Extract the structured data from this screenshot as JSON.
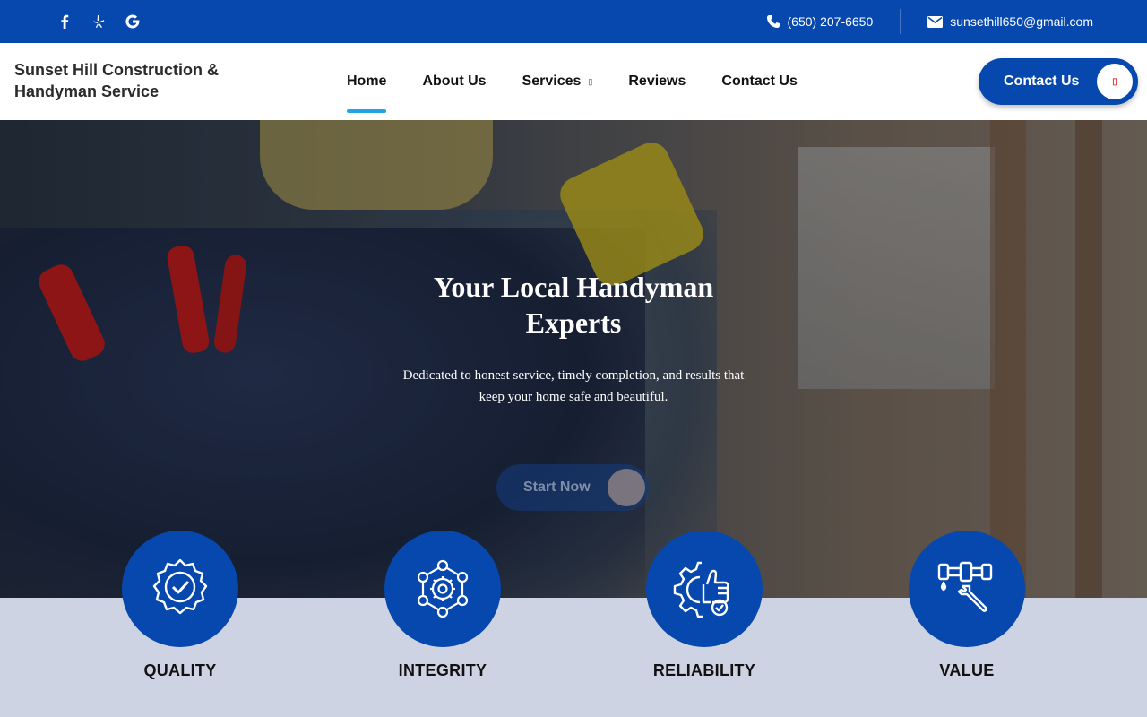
{
  "topbar": {
    "social": [
      {
        "name": "facebook-icon",
        "glyph": "f"
      },
      {
        "name": "yelp-icon",
        "glyph": "✻"
      },
      {
        "name": "google-icon",
        "glyph": "G"
      }
    ],
    "phone": "(650) 207-6650",
    "email": "sunsethill650@gmail.com"
  },
  "header": {
    "logo_line1": "Sunset Hill Construction &",
    "logo_line2": "Handyman Service",
    "nav": [
      {
        "label": "Home"
      },
      {
        "label": "About Us"
      },
      {
        "label": "Services"
      },
      {
        "label": "Reviews"
      },
      {
        "label": "Contact Us"
      }
    ],
    "cta_label": "Contact Us"
  },
  "hero": {
    "title": "Your Local Handyman Experts",
    "subtitle": "Dedicated to honest service, timely completion, and results that keep your home safe and beautiful.",
    "button_label": "Start Now"
  },
  "features": [
    {
      "label": "QUALITY",
      "icon": "quality-badge-icon"
    },
    {
      "label": "INTEGRITY",
      "icon": "integrity-network-icon"
    },
    {
      "label": "RELIABILITY",
      "icon": "reliability-gear-thumb-icon"
    },
    {
      "label": "VALUE",
      "icon": "value-pipe-wrench-icon"
    }
  ],
  "colors": {
    "brand": "#0648ad",
    "accent": "#21a4e6",
    "band": "#cdd3e2"
  }
}
